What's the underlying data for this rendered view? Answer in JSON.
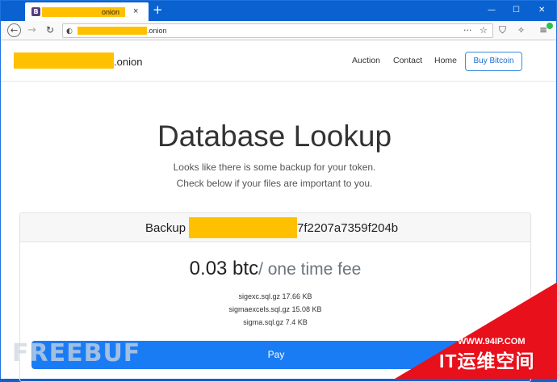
{
  "browser": {
    "tab_favicon_letter": "B",
    "tab_title": "onion",
    "tab_close_glyph": "×",
    "new_tab_glyph": "+",
    "window_controls": [
      "—",
      "☐",
      "✕"
    ],
    "address": ".onion",
    "nav_icons": [
      "back-icon",
      "forward-icon",
      "reload-icon",
      "site-info-icon"
    ],
    "toolbar_icons": [
      "page-actions-icon",
      "bookmark-star-icon",
      "shield-icon",
      "tracking-icon",
      "menu-icon"
    ]
  },
  "site": {
    "brand_suffix": ".onion",
    "nav": [
      "Auction",
      "Contact",
      "Home"
    ],
    "buy_button": "Buy Bitcoin"
  },
  "hero": {
    "title": "Database Lookup",
    "lead_line1": "Looks like there is some backup for your token.",
    "lead_line2": "Check below if your files are important to you."
  },
  "card": {
    "header_label": "Backup",
    "header_hash_suffix": "7f2207a7359f204b",
    "price_amount": "0.03 btc",
    "price_fee": "/ one time fee",
    "files": [
      "sigexc.sql.gz 17.66 KB",
      "sigmaexcels.sql.gz 15.08 KB",
      "sigma.sql.gz 7.4 KB"
    ],
    "pay_button": "Pay"
  },
  "overlays": {
    "watermark": "FREEBUF",
    "corner_url": "WWW.94IP.COM",
    "corner_brand": "IT运维空间"
  },
  "colors": {
    "browser_chrome": "#0a62d0",
    "redaction": "#ffc000",
    "primary": "#1a7cf5",
    "corner_badge": "#e8101b"
  }
}
